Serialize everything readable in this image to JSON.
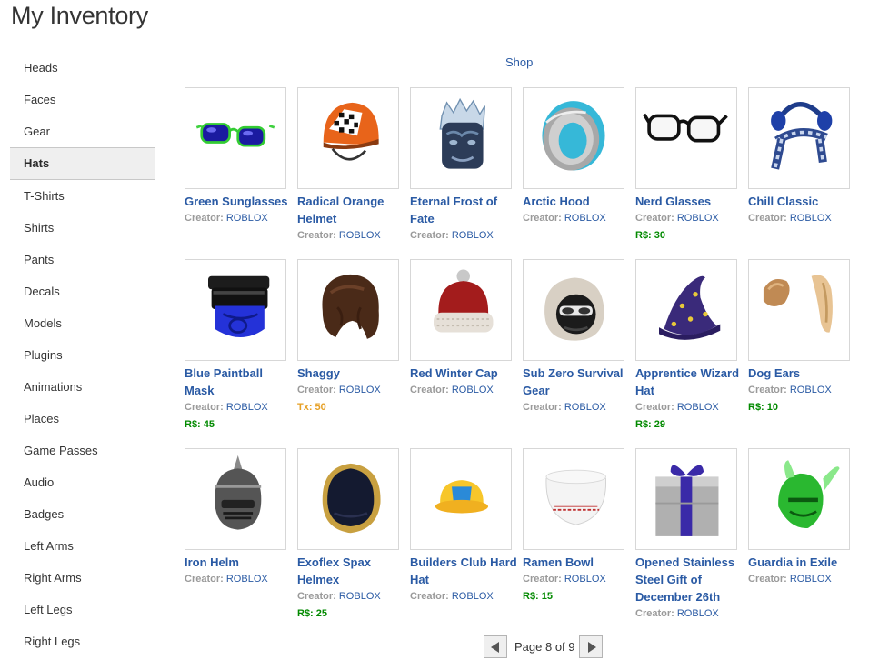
{
  "page_title": "My Inventory",
  "shop_link": "Shop",
  "sidebar": {
    "active_index": 3,
    "items": [
      {
        "label": "Heads"
      },
      {
        "label": "Faces"
      },
      {
        "label": "Gear"
      },
      {
        "label": "Hats"
      },
      {
        "label": "T-Shirts"
      },
      {
        "label": "Shirts"
      },
      {
        "label": "Pants"
      },
      {
        "label": "Decals"
      },
      {
        "label": "Models"
      },
      {
        "label": "Plugins"
      },
      {
        "label": "Animations"
      },
      {
        "label": "Places"
      },
      {
        "label": "Game Passes"
      },
      {
        "label": "Audio"
      },
      {
        "label": "Badges"
      },
      {
        "label": "Left Arms"
      },
      {
        "label": "Right Arms"
      },
      {
        "label": "Left Legs"
      },
      {
        "label": "Right Legs"
      }
    ]
  },
  "items": [
    {
      "name": "Green Sunglasses",
      "creator_label": "Creator:",
      "creator": "ROBLOX",
      "price": "",
      "price_type": "",
      "icon": "green-sunglasses-icon"
    },
    {
      "name": "Radical Orange Helmet",
      "creator_label": "Creator:",
      "creator": "ROBLOX",
      "price": "",
      "price_type": "",
      "icon": "orange-helmet-icon"
    },
    {
      "name": "Eternal Frost of Fate",
      "creator_label": "Creator:",
      "creator": "ROBLOX",
      "price": "",
      "price_type": "",
      "icon": "frost-crown-icon"
    },
    {
      "name": "Arctic Hood",
      "creator_label": "Creator:",
      "creator": "ROBLOX",
      "price": "",
      "price_type": "",
      "icon": "arctic-hood-icon"
    },
    {
      "name": "Nerd Glasses",
      "creator_label": "Creator:",
      "creator": "ROBLOX",
      "price": "R$: 30",
      "price_type": "robux",
      "icon": "nerd-glasses-icon"
    },
    {
      "name": "Chill Classic",
      "creator_label": "Creator:",
      "creator": "ROBLOX",
      "price": "",
      "price_type": "",
      "icon": "earmuffs-scarf-icon"
    },
    {
      "name": "Blue Paintball Mask",
      "creator_label": "Creator:",
      "creator": "ROBLOX",
      "price": "R$: 45",
      "price_type": "robux",
      "icon": "paintball-mask-icon"
    },
    {
      "name": "Shaggy",
      "creator_label": "Creator:",
      "creator": "ROBLOX",
      "price": "Tx: 50",
      "price_type": "tix",
      "icon": "shaggy-hair-icon"
    },
    {
      "name": "Red Winter Cap",
      "creator_label": "Creator:",
      "creator": "ROBLOX",
      "price": "",
      "price_type": "",
      "icon": "winter-cap-icon"
    },
    {
      "name": "Sub Zero Survival Gear",
      "creator_label": "Creator:",
      "creator": "ROBLOX",
      "price": "",
      "price_type": "",
      "icon": "survival-hood-icon"
    },
    {
      "name": "Apprentice Wizard Hat",
      "creator_label": "Creator:",
      "creator": "ROBLOX",
      "price": "R$: 29",
      "price_type": "robux",
      "icon": "wizard-hat-icon"
    },
    {
      "name": "Dog Ears",
      "creator_label": "Creator:",
      "creator": "ROBLOX",
      "price": "R$: 10",
      "price_type": "robux",
      "icon": "dog-ears-icon"
    },
    {
      "name": "Iron Helm",
      "creator_label": "Creator:",
      "creator": "ROBLOX",
      "price": "",
      "price_type": "",
      "icon": "iron-helm-icon"
    },
    {
      "name": "Exoflex Spax Helmex",
      "creator_label": "Creator:",
      "creator": "ROBLOX",
      "price": "R$: 25",
      "price_type": "robux",
      "icon": "exoflex-helmet-icon"
    },
    {
      "name": "Builders Club Hard Hat",
      "creator_label": "Creator:",
      "creator": "ROBLOX",
      "price": "",
      "price_type": "",
      "icon": "hard-hat-icon"
    },
    {
      "name": "Ramen Bowl",
      "creator_label": "Creator:",
      "creator": "ROBLOX",
      "price": "R$: 15",
      "price_type": "robux",
      "icon": "ramen-bowl-icon"
    },
    {
      "name": "Opened Stainless Steel Gift of December 26th",
      "creator_label": "Creator:",
      "creator": "ROBLOX",
      "price": "",
      "price_type": "",
      "icon": "gift-box-icon"
    },
    {
      "name": "Guardia in Exile",
      "creator_label": "Creator:",
      "creator": "ROBLOX",
      "price": "",
      "price_type": "",
      "icon": "green-helmet-icon"
    }
  ],
  "pager": {
    "text": "Page 8 of 9",
    "current": 8,
    "total": 9
  }
}
